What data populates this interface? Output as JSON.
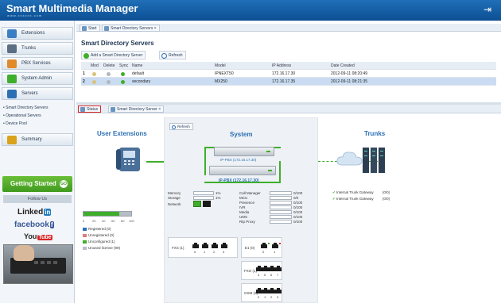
{
  "app": {
    "title": "Smart Multimedia Manager",
    "subtitle": "www.xxxxxx.com"
  },
  "sidebar": {
    "items": [
      {
        "label": "Extensions",
        "icon": "extensions-icon",
        "color": "#3d7fc4"
      },
      {
        "label": "Trunks",
        "icon": "trunks-icon",
        "color": "#5a6e84"
      },
      {
        "label": "PBX Services",
        "icon": "pbx-services-icon",
        "color": "#e08a2a"
      },
      {
        "label": "System Admin",
        "icon": "system-admin-icon",
        "color": "#3fae2b"
      },
      {
        "label": "Servers",
        "icon": "servers-icon",
        "color": "#2b6fb5"
      },
      {
        "label": "Summary",
        "icon": "summary-icon",
        "color": "#d9a21b"
      }
    ],
    "subitems": [
      "Smart Directory Servers",
      "Operational Servers",
      "Device Pool"
    ],
    "getting_started": "Getting Started",
    "getting_started_go": "GO",
    "follow_us": "Follow Us",
    "social": {
      "linkedin": "Linked",
      "linkedin_tag": "in",
      "facebook": "facebook",
      "facebook_tag": "f",
      "youtube": "You",
      "youtube_tag": "Tube"
    }
  },
  "top_tabs": [
    "Start",
    "Smart Directory Servers"
  ],
  "page_title": "Smart Directory Servers",
  "toolbar": {
    "add": "Add a Smart Directory Server",
    "refresh": "Refresh"
  },
  "grid": {
    "columns": [
      "Mod",
      "Delete",
      "Sync",
      "Name",
      "Model",
      "IP Address",
      "Date Created"
    ],
    "rows": [
      {
        "num": "1",
        "name": "default",
        "model": "IPNEXT50",
        "ip": "172.16.17.30",
        "date": "2012-09-11 08:20:49"
      },
      {
        "num": "2",
        "name": "secondary",
        "model": "MX250",
        "ip": "172.16.17.35",
        "date": "2012-09-11 08:21:35"
      }
    ]
  },
  "bottom_tabs": [
    "Status",
    "Smart Directory Server"
  ],
  "status": {
    "headers": {
      "user_ext": "User Extensions",
      "system": "System",
      "trunks": "Trunks"
    },
    "refresh": "Refresh",
    "ip_pbx_1": "IP-PBX (172.16.17.30)",
    "ip_pbx_2": "IP-PBX (172.16.17.30)",
    "axis_ticks": [
      "0",
      "20",
      "40",
      "60",
      "80",
      "100"
    ],
    "usage_fill": 0.75,
    "legend": [
      {
        "label": "Registered (0)",
        "color": "#2b6fb5"
      },
      {
        "label": "Unregistered (0)",
        "color": "#e07b7b"
      },
      {
        "label": "Unconfigured (1)",
        "color": "#3fae2b"
      },
      {
        "label": "Unused license (99)",
        "color": "#b6bdc5"
      }
    ],
    "metrics_left": [
      {
        "label": "Memory",
        "value": "1%",
        "fill": 0.01
      },
      {
        "label": "Storage",
        "value": "1%",
        "fill": 0.01
      },
      {
        "label": "Network",
        "value": "",
        "fill": 0
      }
    ],
    "metrics_right": [
      {
        "label": "Call Manager",
        "value": "0/100"
      },
      {
        "label": "MCU",
        "value": "0/0"
      },
      {
        "label": "Presence",
        "value": "0/100"
      },
      {
        "label": "IVR",
        "value": "0/100"
      },
      {
        "label": "Media",
        "value": "0/100"
      },
      {
        "label": "UMS",
        "value": "0/100"
      },
      {
        "label": "Rtp Proxy",
        "value": "0/100"
      }
    ],
    "panels": {
      "fxs": {
        "label": "FXS (1)",
        "ports": [
          "0",
          "1",
          "2",
          "3"
        ]
      },
      "e1": {
        "label": "E1 (0)",
        "ports": [
          "0",
          "1"
        ]
      },
      "fxo": {
        "label": "FXO (1)",
        "ports": [
          "4",
          "5",
          "6",
          "7"
        ]
      },
      "gsm": {
        "label": "GSM (2)",
        "ports": [
          "0",
          "1",
          "2",
          "3"
        ]
      }
    },
    "trunks": [
      {
        "label": "Internal Trunk Gateway",
        "value": "(0/0)"
      },
      {
        "label": "Internal Trunk Gateway",
        "value": "(0/0)"
      }
    ]
  }
}
